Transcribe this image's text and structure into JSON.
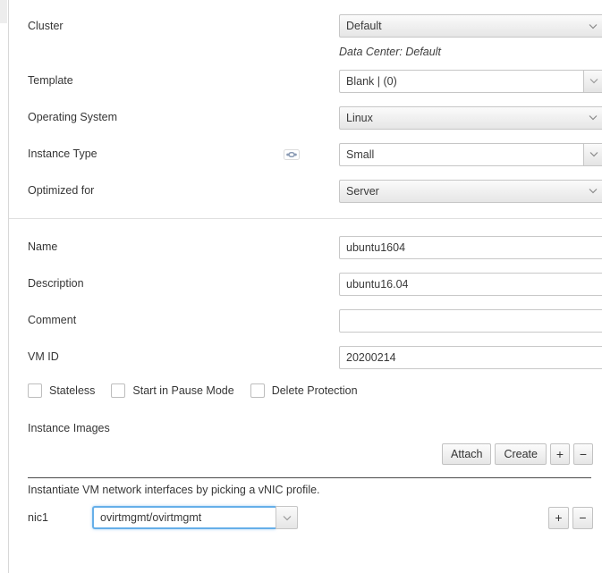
{
  "form": {
    "top_section": {
      "cluster": {
        "label": "Cluster",
        "value": "Default",
        "helper": "Data Center: Default",
        "caret_icon": "chevron-down-icon"
      },
      "template": {
        "label": "Template",
        "value": "Blank |  (0)",
        "caret_icon": "chevron-down-icon"
      },
      "operating_system": {
        "label": "Operating System",
        "value": "Linux",
        "caret_icon": "chevron-down-icon"
      },
      "instance_type": {
        "label": "Instance Type",
        "value": "Small",
        "link_icon": "chain-link-icon",
        "caret_icon": "chevron-down-icon"
      },
      "optimized_for": {
        "label": "Optimized for",
        "value": "Server",
        "caret_icon": "chevron-down-icon"
      }
    },
    "details_section": {
      "name": {
        "label": "Name",
        "value": "ubuntu1604",
        "placeholder": ""
      },
      "description": {
        "label": "Description",
        "value": "ubuntu16.04",
        "placeholder": ""
      },
      "comment": {
        "label": "Comment",
        "value": "",
        "placeholder": ""
      },
      "vm_id": {
        "label": "VM ID",
        "value": "20200214",
        "placeholder": ""
      },
      "checkboxes": [
        {
          "label": "Stateless",
          "checked": false
        },
        {
          "label": "Start in Pause Mode",
          "checked": false
        },
        {
          "label": "Delete Protection",
          "checked": false
        }
      ],
      "instance_images": {
        "label": "Instance Images",
        "attach_label": "Attach",
        "create_label": "Create",
        "add_label": "+",
        "remove_label": "−"
      }
    },
    "network_section": {
      "note": "Instantiate VM network interfaces by picking a vNIC profile.",
      "nic": {
        "label": "nic1",
        "value": "ovirtmgmt/ovirtmgmt",
        "caret_icon": "chevron-down-icon",
        "add_label": "+",
        "remove_label": "−"
      }
    }
  },
  "colors": {
    "focus_ring": "#66afe9",
    "text": "#363636",
    "border": "#c6c6c6",
    "divider": "#e0e0e0"
  }
}
